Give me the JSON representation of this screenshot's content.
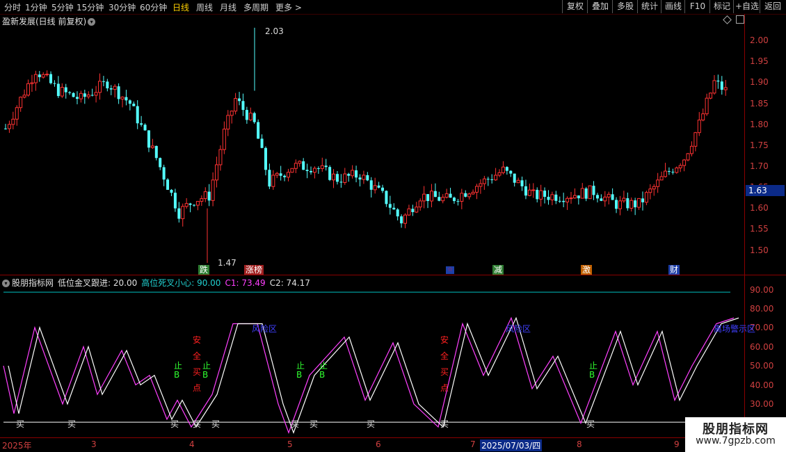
{
  "toolbar": {
    "tabs": [
      "分时",
      "1分钟",
      "5分钟",
      "15分钟",
      "30分钟",
      "60分钟",
      "日线",
      "周线",
      "月线",
      "多周期",
      "更多 >"
    ],
    "active_tab": "日线",
    "right_buttons": [
      "复权",
      "叠加",
      "多股",
      "统计",
      "画线",
      "F10",
      "标记",
      "+自选",
      "返回"
    ]
  },
  "main_chart": {
    "title": "盈新发展(日线 前复权)",
    "title_icon": "chevron-down-icon",
    "price_ticks": [
      "2.00",
      "1.95",
      "1.90",
      "1.85",
      "1.80",
      "1.75",
      "1.70",
      "1.65",
      "1.60",
      "1.55",
      "1.50"
    ],
    "current_price": "1.63",
    "high_annotation": "2.03",
    "low_annotation": "1.47",
    "signals": [
      {
        "text": "跌",
        "color": "#ffffff",
        "bg": "#2e7d32"
      },
      {
        "text": "涨榜",
        "color": "#ffffff",
        "bg": "#a02020"
      },
      {
        "text": "☆",
        "color": "#e0202d",
        "bg": "#1e3fa8"
      },
      {
        "text": "减",
        "color": "#ffffff",
        "bg": "#2e7d32"
      },
      {
        "text": "激",
        "color": "#ffffff",
        "bg": "#c06000"
      },
      {
        "text": "财",
        "color": "#ffffff",
        "bg": "#1e3fa8"
      }
    ],
    "colors": {
      "up": "#ff3232",
      "down": "#54ffff",
      "axis": "#8b0000"
    }
  },
  "indicator": {
    "name": "股朋指标网",
    "low_gold_cross": "低位金叉跟进: 20.00",
    "high_dead_cross": "高位死叉小心: 90.00",
    "c1": "C1: 73.49",
    "c2": "C2: 74.17",
    "ticks": [
      "90.00",
      "80.00",
      "70.00",
      "60.00",
      "50.00",
      "40.00",
      "30.00"
    ],
    "risk_label": "风险区",
    "risk_label_2": "离场警示区",
    "safe_buy_chars": [
      "安",
      "全",
      "买",
      "点"
    ],
    "stop_b": [
      "止",
      "B"
    ],
    "buy_label": "买",
    "colors": {
      "c1": "#ff40ff",
      "c2": "#ffffff",
      "guide": "#00c0c0",
      "stop_b": "#30ff30",
      "safe": "#ff2020",
      "risk": "#4040ff"
    }
  },
  "date_axis": {
    "labels": [
      "2025年",
      "3",
      "4",
      "5",
      "6",
      "7",
      "8",
      "9"
    ],
    "cursor_date": "2025/07/03/四"
  },
  "watermark": {
    "line1": "股朋指标网",
    "line2": "www.7gpzb.com"
  }
}
